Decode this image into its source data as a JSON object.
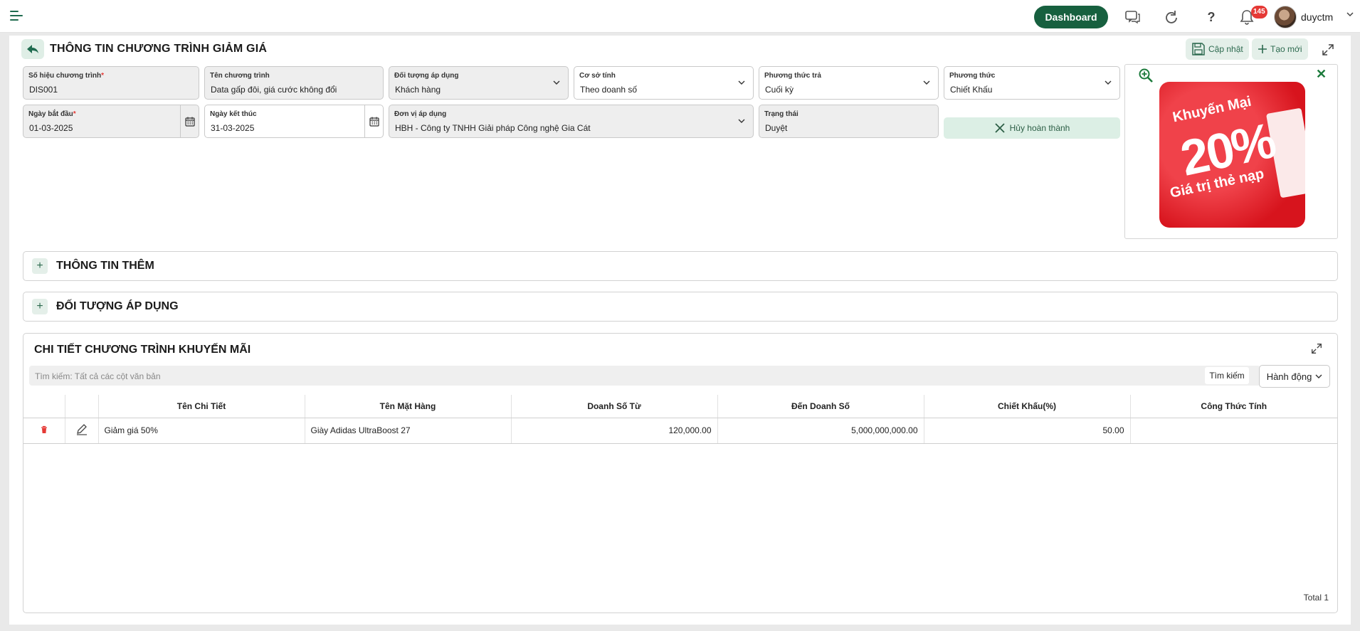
{
  "topbar": {
    "dashboard_label": "Dashboard",
    "notification_count": "145",
    "username": "duyctm"
  },
  "header": {
    "title": "THÔNG TIN CHƯƠNG TRÌNH GIẢM GIÁ",
    "update_label": "Cập nhật",
    "new_label": "Tạo mới"
  },
  "form": {
    "program_code": {
      "label": "Số hiệu chương trình",
      "value": "DIS001"
    },
    "program_name": {
      "label": "Tên chương trình",
      "value": "Data gấp đôi, giá cước không đổi"
    },
    "target": {
      "label": "Đối tượng áp dụng",
      "value": "Khách hàng"
    },
    "basis": {
      "label": "Cơ sở tính",
      "value": "Theo doanh số"
    },
    "payment_method": {
      "label": "Phương thức trả",
      "value": "Cuối kỳ"
    },
    "method": {
      "label": "Phương thức",
      "value": "Chiết Khấu"
    },
    "start_date": {
      "label": "Ngày bắt đầu",
      "value": "01-03-2025"
    },
    "end_date": {
      "label": "Ngày kết thúc",
      "value": "31-03-2025"
    },
    "unit": {
      "label": "Đơn vị áp dụng",
      "value": "HBH - Công ty TNHH Giải pháp Công nghệ Gia Cát"
    },
    "status": {
      "label": "Trạng thái",
      "value": "Duyệt"
    },
    "cancel_complete_label": "Hủy hoàn thành"
  },
  "promo_image": {
    "line1": "Khuyến Mại",
    "line2": "20%",
    "line3": "Giá trị thẻ nạp"
  },
  "sections": {
    "more_info": "THÔNG TIN THÊM",
    "targets": "ĐỐI TƯỢNG ÁP DỤNG"
  },
  "detail": {
    "title": "CHI TIẾT CHƯƠNG TRÌNH KHUYẾN MÃI",
    "search_placeholder": "Tìm kiếm: Tất cả các cột văn bản",
    "search_label": "Tìm kiếm",
    "action_label": "Hành động",
    "columns": [
      "Tên Chi Tiết",
      "Tên Mặt Hàng",
      "Doanh Số Từ",
      "Đến Doanh Số",
      "Chiết Khấu(%)",
      "Công Thức Tính"
    ],
    "rows": [
      {
        "name": "Giảm giá 50%",
        "product": "Giày Adidas UltraBoost 27",
        "from": "120,000.00",
        "to": "5,000,000,000.00",
        "discount": "50.00",
        "formula": ""
      }
    ],
    "total": "Total 1"
  },
  "colors": {
    "primary": "#17603f",
    "accent_light": "#e4efe9",
    "badge": "#e53935"
  }
}
